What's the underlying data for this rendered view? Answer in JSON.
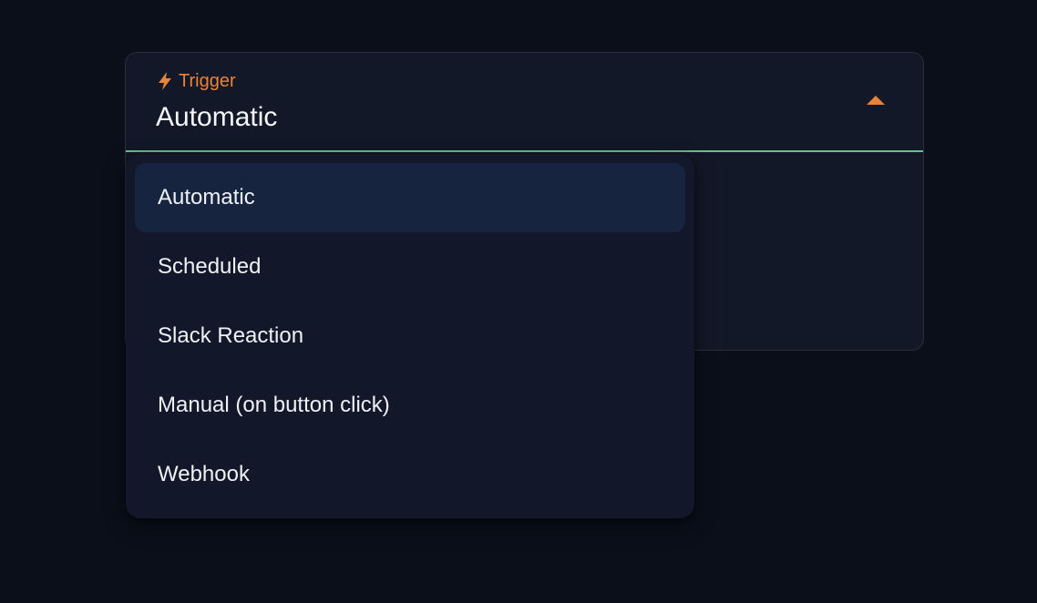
{
  "select": {
    "label": "Trigger",
    "label_icon": "bolt-icon",
    "value": "Automatic",
    "caret_icon": "caret-up-icon",
    "accent_color": "#e8833a",
    "focus_underline_color": "#5ec58a"
  },
  "menu": {
    "items": [
      {
        "label": "Automatic",
        "selected": true
      },
      {
        "label": "Scheduled",
        "selected": false
      },
      {
        "label": "Slack Reaction",
        "selected": false
      },
      {
        "label": "Manual (on button click)",
        "selected": false
      },
      {
        "label": "Webhook",
        "selected": false
      }
    ]
  }
}
